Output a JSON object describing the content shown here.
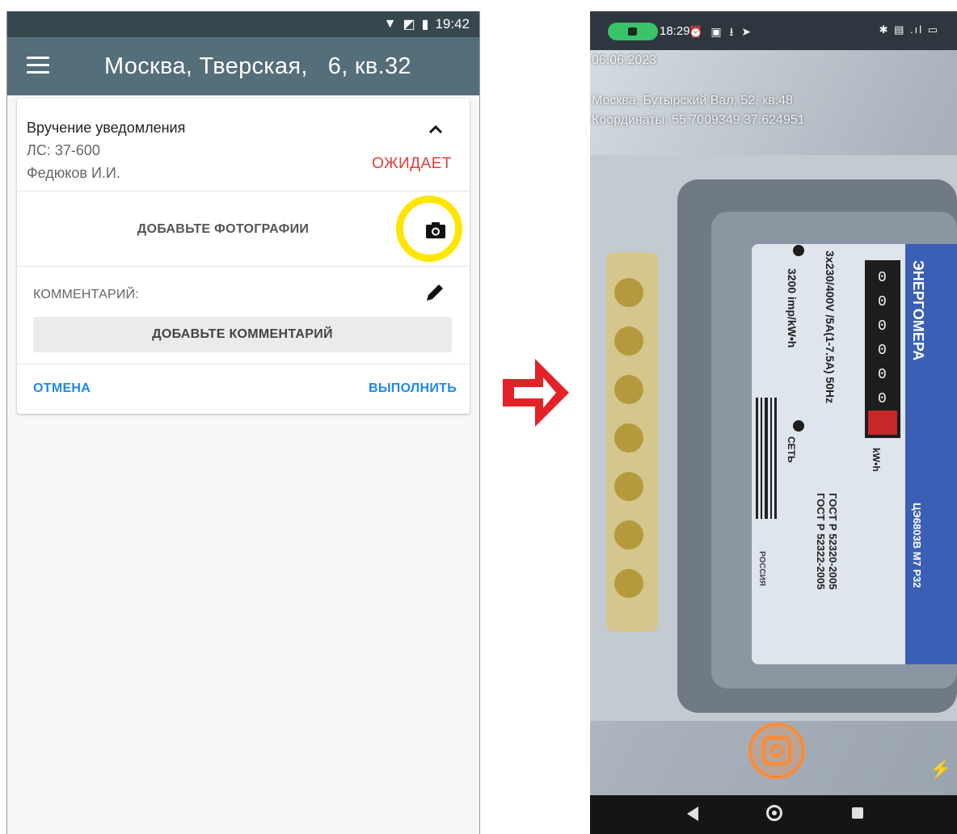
{
  "left_screen": {
    "status_bar": {
      "time": "19:42",
      "icons": [
        "wifi-icon",
        "no-sim-icon",
        "battery-icon"
      ]
    },
    "app_bar": {
      "title": "Москва, Тверская,   6, кв.32",
      "menu_icon": "hamburger-menu-icon"
    },
    "task": {
      "title": "Вручение уведомления",
      "account": "ЛС: 37-600",
      "person": "Федюков И.И.",
      "status": "ОЖИДАЕТ",
      "status_color": "#e53935"
    },
    "photos": {
      "label": "ДОБАВЬТЕ ФОТОГРАФИИ",
      "icon": "camera-icon",
      "highlight_color": "#ffe600"
    },
    "comment": {
      "label": "КОММЕНТАРИЙ:",
      "button": "ДОБАВЬТЕ КОММЕНТАРИЙ",
      "icon": "edit-pencil-icon"
    },
    "actions": {
      "cancel": "ОТМЕНА",
      "execute": "ВЫПОЛНИТЬ",
      "color": "#1e88e5"
    }
  },
  "arrow": {
    "icon": "right-arrow-icon",
    "color": "#e32227"
  },
  "right_screen": {
    "status_bar": {
      "time": "18:29"
    },
    "overlay": {
      "date": "06.06.2023",
      "address": "Москва, Бутырский Вал,  52, кв.48",
      "coords": "Координаты: 55.7009349 37.624951"
    },
    "meter_labels": {
      "brand": "ЭНЕРГОМЕРА",
      "spec": "3x230/400V /5A(1-7.5A) 50Hz",
      "imp": "3200 imp/kW•h",
      "net": "СЕТЬ",
      "unit": "kW•h",
      "gost1": "ГОСТ Р 52320-2005",
      "gost2": "ГОСТ Р 52322-2005",
      "country": "РОССИЯ",
      "model": "ЦЭ6803В М7 Р32",
      "reading": "0000004"
    },
    "controls": {
      "shutter_icon": "shutter-icon",
      "flash_icon": "flash-icon"
    }
  }
}
